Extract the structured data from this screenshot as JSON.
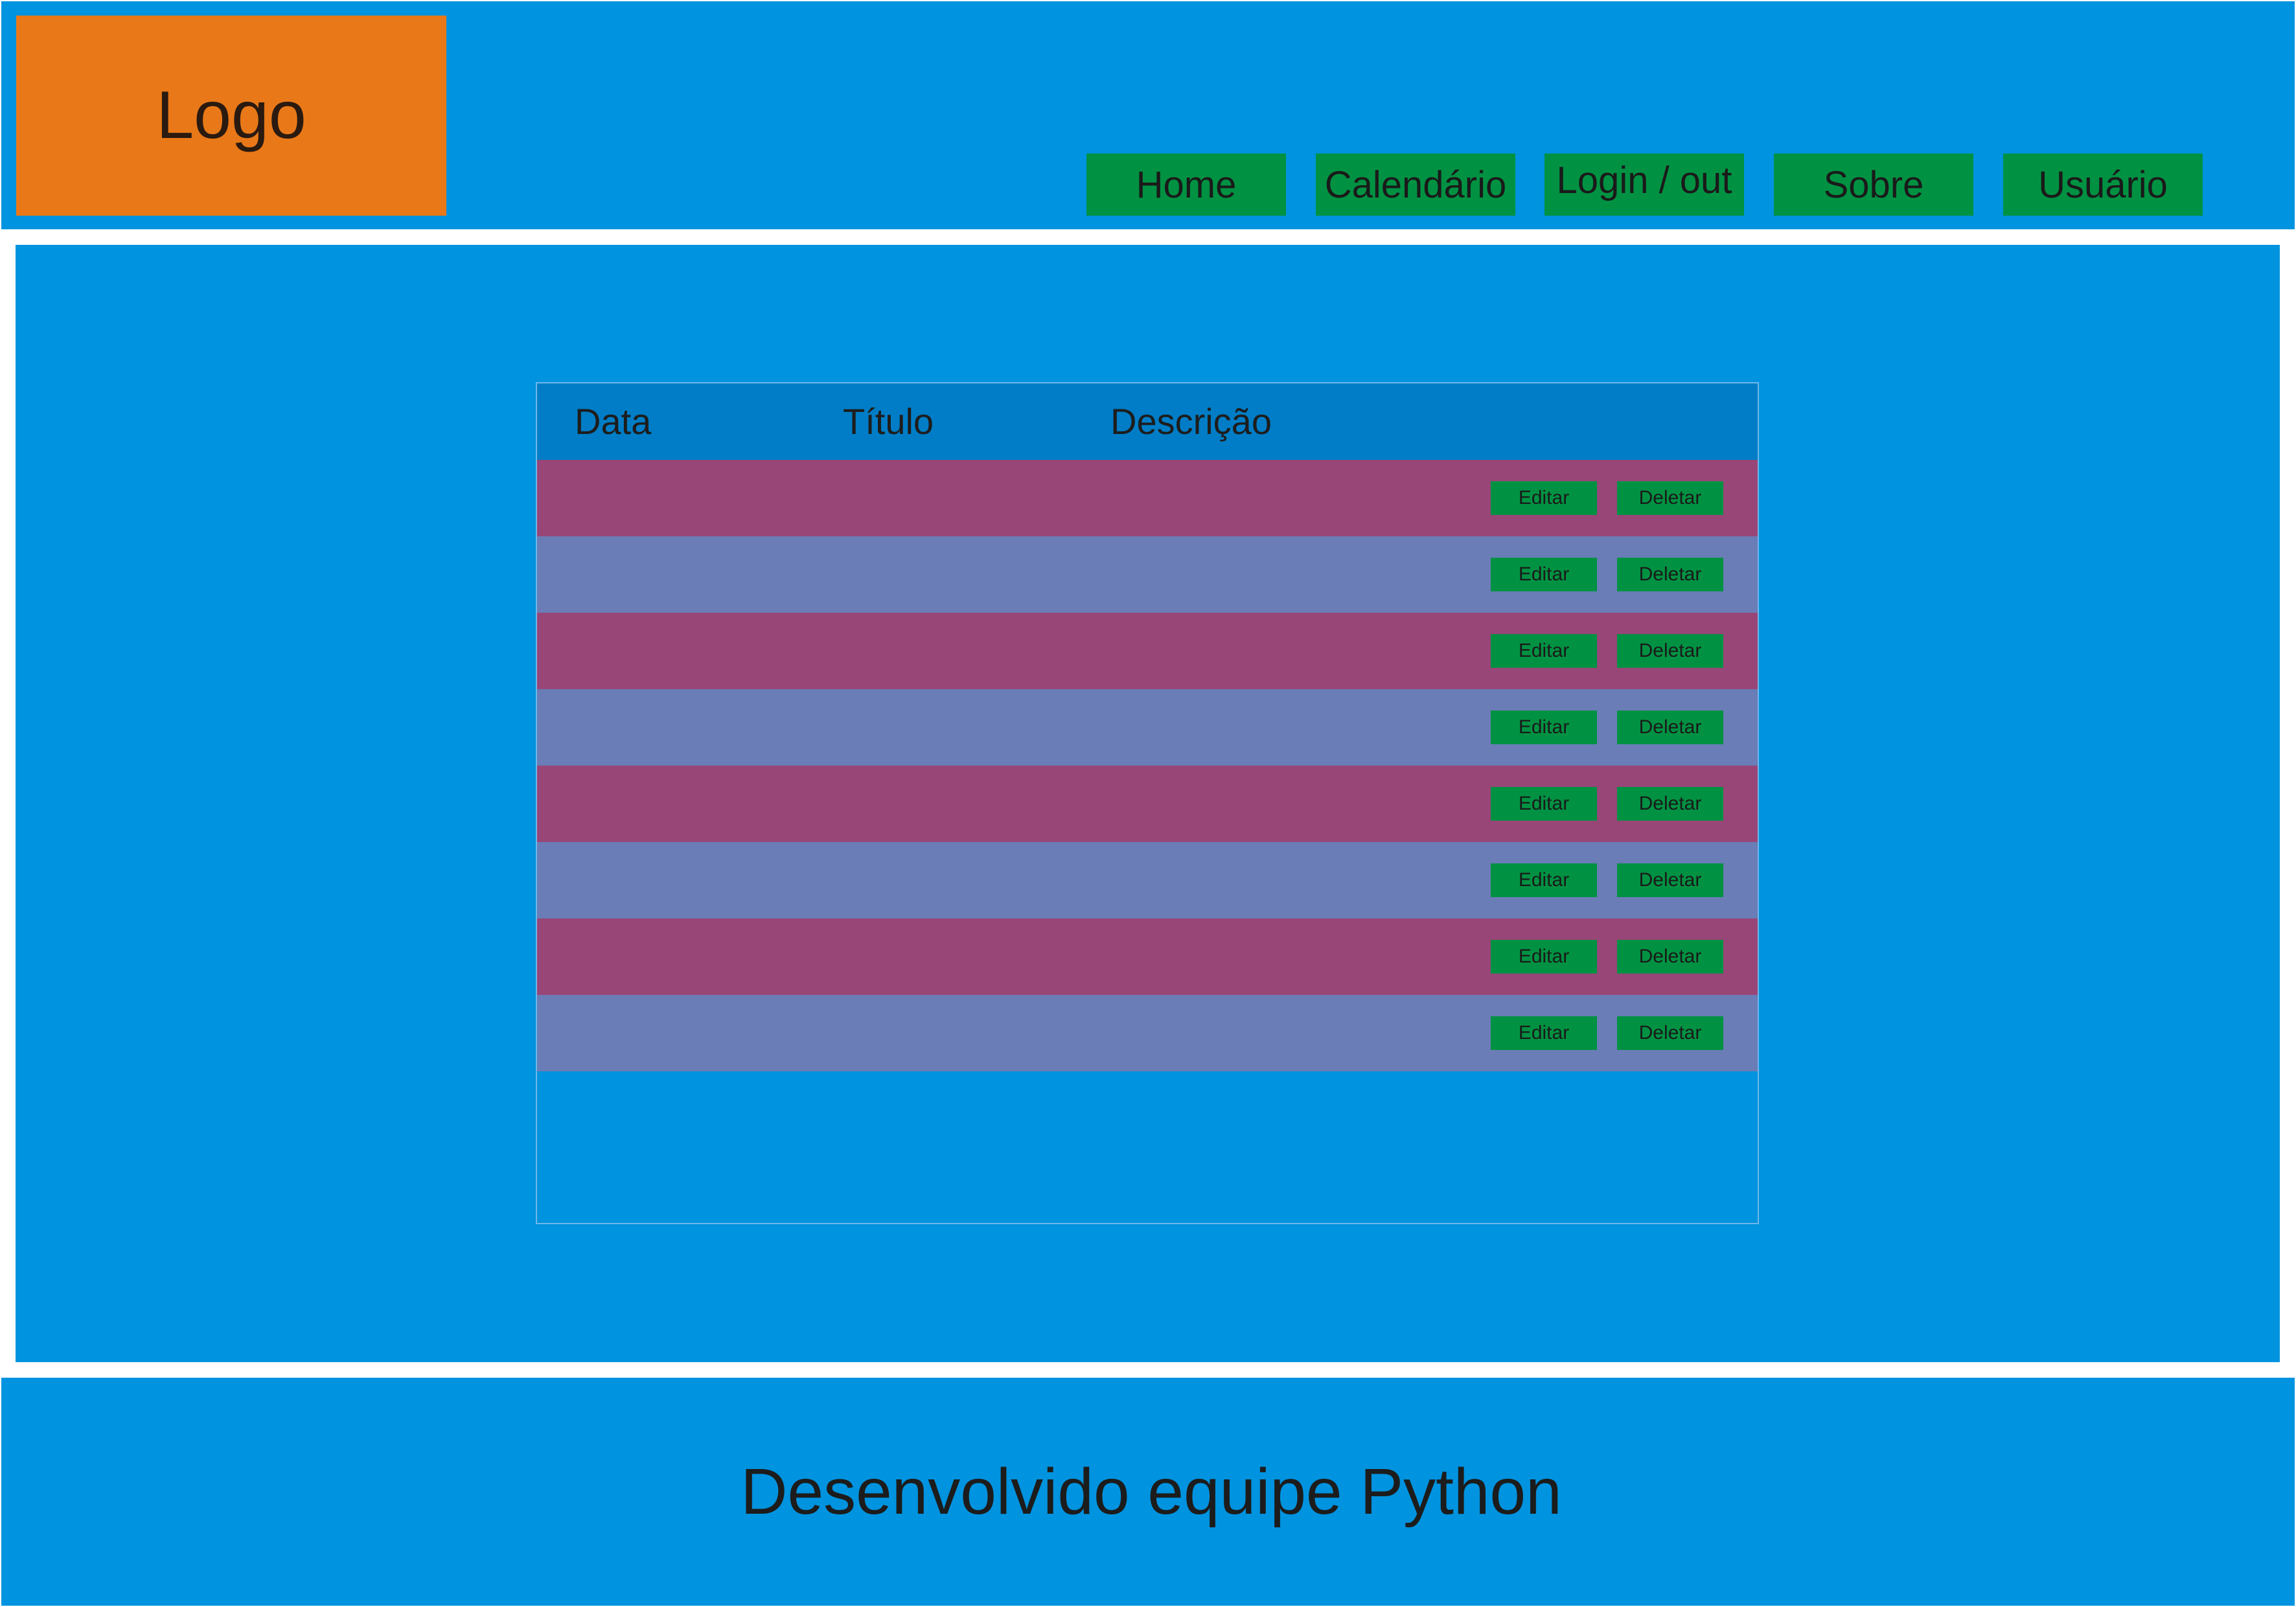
{
  "header": {
    "logo_text": "Logo",
    "nav": [
      {
        "label": "Home"
      },
      {
        "label": "Calendário"
      },
      {
        "label": "Login / out"
      },
      {
        "label": "Sobre"
      },
      {
        "label": "Usuário"
      }
    ]
  },
  "table": {
    "columns": [
      "Data",
      "Título",
      "Descrição"
    ],
    "rows": [
      {
        "data": "",
        "titulo": "",
        "descricao": "",
        "edit_label": "Editar",
        "delete_label": "Deletar"
      },
      {
        "data": "",
        "titulo": "",
        "descricao": "",
        "edit_label": "Editar",
        "delete_label": "Deletar"
      },
      {
        "data": "",
        "titulo": "",
        "descricao": "",
        "edit_label": "Editar",
        "delete_label": "Deletar"
      },
      {
        "data": "",
        "titulo": "",
        "descricao": "",
        "edit_label": "Editar",
        "delete_label": "Deletar"
      },
      {
        "data": "",
        "titulo": "",
        "descricao": "",
        "edit_label": "Editar",
        "delete_label": "Deletar"
      },
      {
        "data": "",
        "titulo": "",
        "descricao": "",
        "edit_label": "Editar",
        "delete_label": "Deletar"
      },
      {
        "data": "",
        "titulo": "",
        "descricao": "",
        "edit_label": "Editar",
        "delete_label": "Deletar"
      },
      {
        "data": "",
        "titulo": "",
        "descricao": "",
        "edit_label": "Editar",
        "delete_label": "Deletar"
      }
    ]
  },
  "footer": {
    "text": "Desenvolvido equipe Python"
  },
  "colors": {
    "background": "#0093df",
    "logo": "#e97818",
    "button": "#009242",
    "table_header": "#007dc6",
    "row_odd": "#984677",
    "row_even": "#6a7db6"
  }
}
